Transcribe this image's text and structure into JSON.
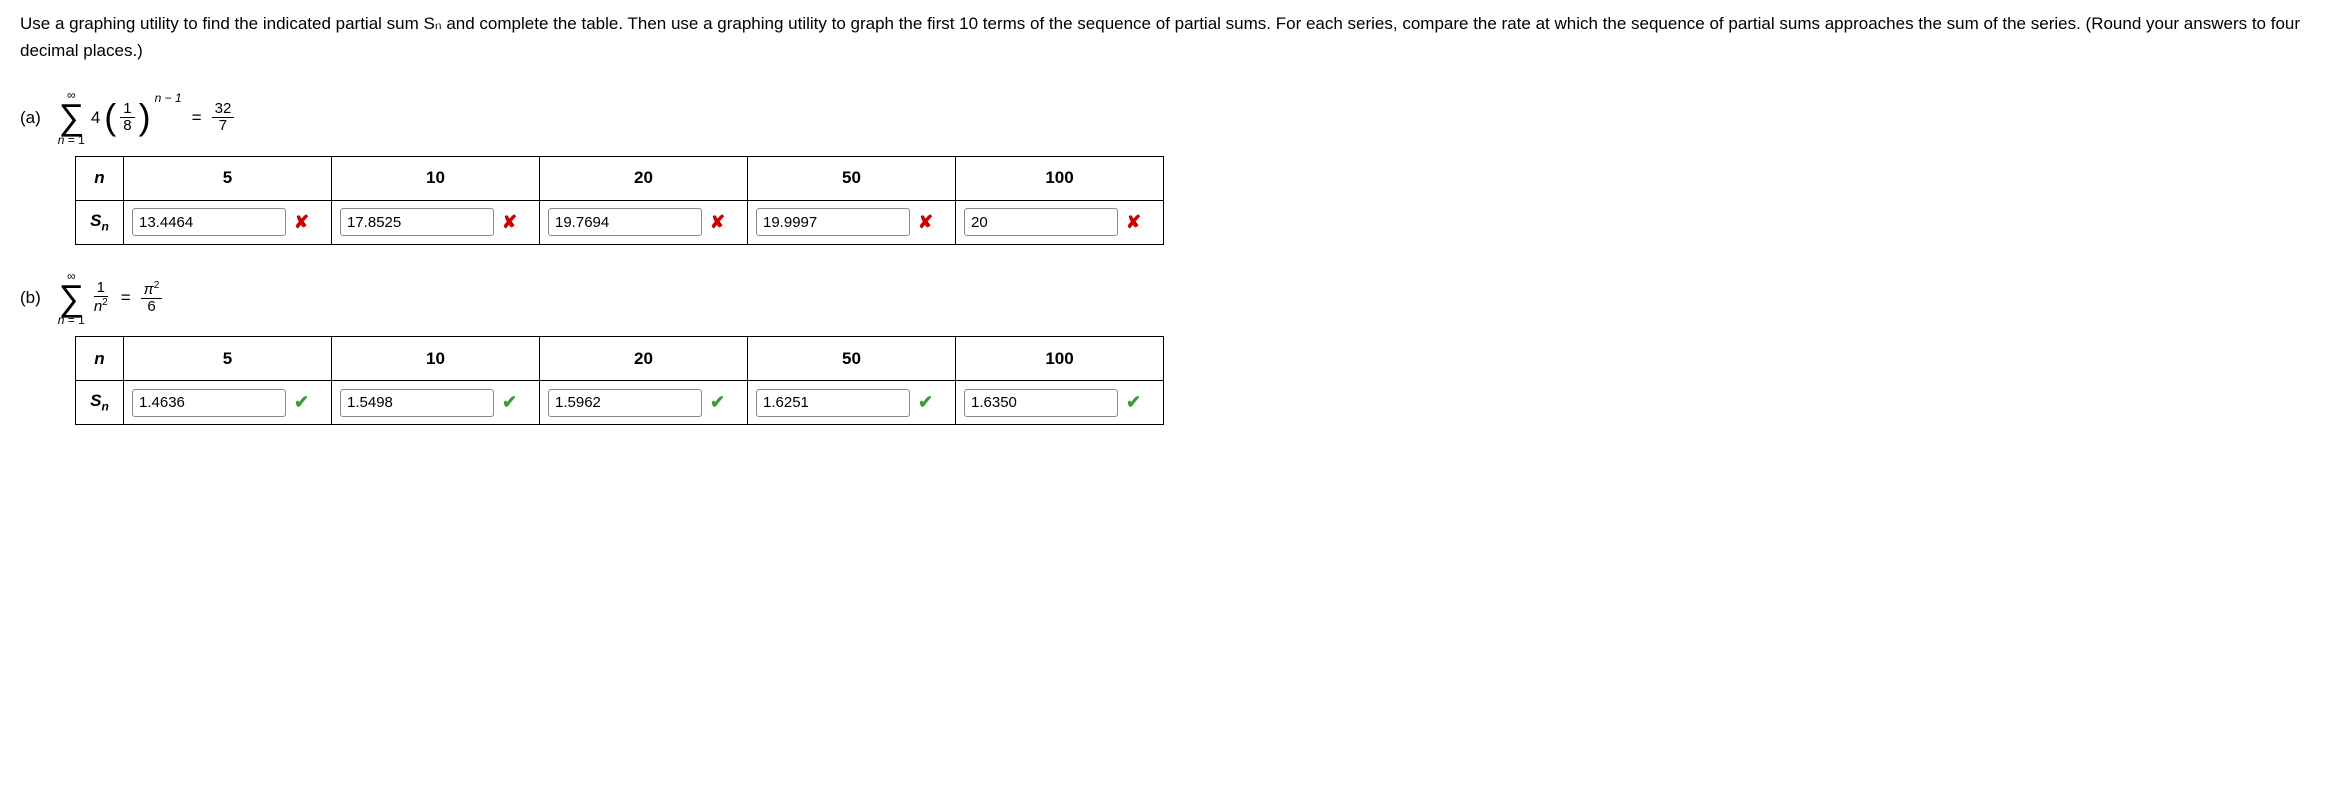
{
  "instructions": "Use a graphing utility to find the indicated partial sum Sₙ and complete the table. Then use a graphing utility to graph the first 10 terms of the sequence of partial sums. For each series, compare the rate at which the sequence of partial sums approaches the sum of the series. (Round your answers to four decimal places.)",
  "parts": {
    "a": {
      "label": "(a)",
      "formula": {
        "sigma_top": "∞",
        "sigma_bottom_var": "n",
        "sigma_bottom_eq": "= 1",
        "coeff": "4",
        "inner_num": "1",
        "inner_den": "8",
        "exp": "n − 1",
        "eq": "=",
        "rhs_num": "32",
        "rhs_den": "7"
      },
      "table": {
        "header_n": "n",
        "header_sn": "Sₙ",
        "cols": [
          "5",
          "10",
          "20",
          "50",
          "100"
        ],
        "values": [
          "13.4464",
          "17.8525",
          "19.7694",
          "19.9997",
          "20"
        ],
        "marks": [
          "wrong",
          "wrong",
          "wrong",
          "wrong",
          "wrong"
        ]
      }
    },
    "b": {
      "label": "(b)",
      "formula": {
        "sigma_top": "∞",
        "sigma_bottom_var": "n",
        "sigma_bottom_eq": "= 1",
        "term_num": "1",
        "term_den_base": "n",
        "term_den_exp": "2",
        "eq": "=",
        "rhs_num_base": "π",
        "rhs_num_exp": "2",
        "rhs_den": "6"
      },
      "table": {
        "header_n": "n",
        "header_sn": "Sₙ",
        "cols": [
          "5",
          "10",
          "20",
          "50",
          "100"
        ],
        "values": [
          "1.4636",
          "1.5498",
          "1.5962",
          "1.6251",
          "1.6350"
        ],
        "marks": [
          "right",
          "right",
          "right",
          "right",
          "right"
        ]
      }
    }
  },
  "chart_data": [
    {
      "type": "table",
      "title": "Partial sums Sₙ for Σ 4(1/8)^(n−1) = 32/7",
      "columns": [
        "n",
        "Sₙ"
      ],
      "rows": [
        [
          5,
          13.4464
        ],
        [
          10,
          17.8525
        ],
        [
          20,
          19.7694
        ],
        [
          50,
          19.9997
        ],
        [
          100,
          20
        ]
      ],
      "note": "entries marked incorrect"
    },
    {
      "type": "table",
      "title": "Partial sums Sₙ for Σ 1/n² = π²/6",
      "columns": [
        "n",
        "Sₙ"
      ],
      "rows": [
        [
          5,
          1.4636
        ],
        [
          10,
          1.5498
        ],
        [
          20,
          1.5962
        ],
        [
          50,
          1.6251
        ],
        [
          100,
          1.635
        ]
      ],
      "note": "entries marked correct"
    }
  ]
}
